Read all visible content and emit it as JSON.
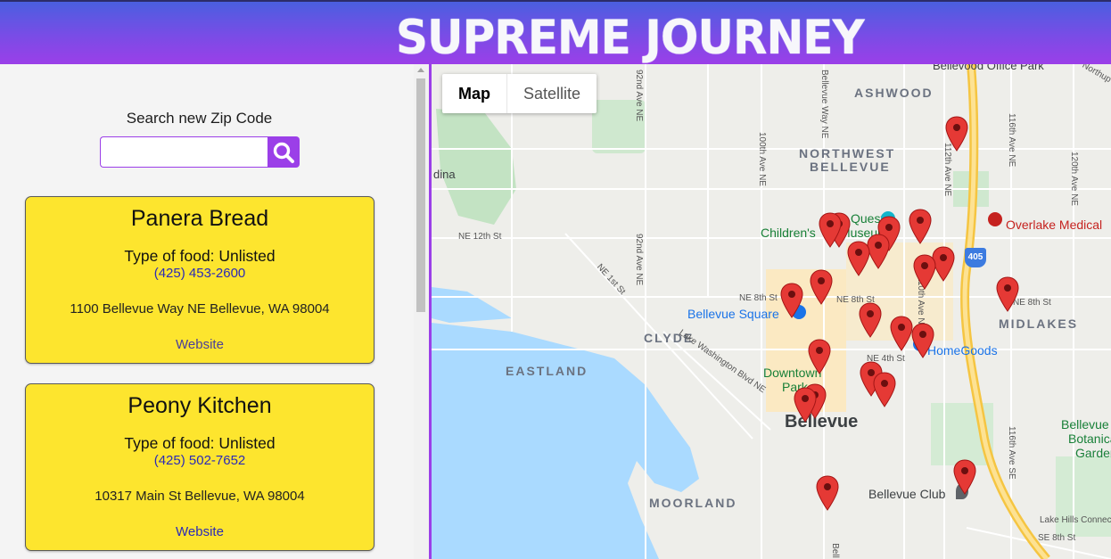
{
  "header": {
    "brand": "SUPREME JOURNEY"
  },
  "search": {
    "label": "Search new Zip Code",
    "value": "",
    "placeholder": "",
    "button_icon": "search-icon"
  },
  "results": [
    {
      "name": "Panera Bread",
      "food_type": "Type of food: Unlisted",
      "phone": "(425) 453-2600",
      "address": "1100 Bellevue Way NE Bellevue, WA 98004",
      "website": "Website"
    },
    {
      "name": "Peony Kitchen",
      "food_type": "Type of food: Unlisted",
      "phone": "(425) 502-7652",
      "address": "10317 Main St Bellevue, WA 98004",
      "website": "Website"
    }
  ],
  "map": {
    "toggle": {
      "map": "Map",
      "satellite": "Satellite"
    },
    "labels": {
      "ashwood": "ASHWOOD",
      "nw_bellevue_1": "NORTHWEST",
      "nw_bellevue_2": "BELLEVUE",
      "clyde": "CLYDE",
      "eastland": "EASTLAND",
      "midlakes": "MIDLAKES",
      "moorland": "MOORLAND",
      "bellevue": "Bellevue",
      "bellevue_square": "Bellevue Square",
      "homegoods": "HomeGoods",
      "overlake": "Overlake Medical",
      "childrens": "Children's",
      "museum": "Museum",
      "quest": "Quest",
      "downtown": "Downtown",
      "park": "Park",
      "botanical_1": "Bellevue",
      "botanical_2": "Botanica",
      "botanical_3": "Garden",
      "club": "Bellevue Club",
      "office_park": "Bellevood Office Park",
      "northup": "Northup",
      "dina": "dina",
      "ne_12th": "NE 12th St",
      "ne_8th_a": "NE 8th St",
      "ne_8th_b": "NE 8th St",
      "ne_8th_c": "NE 8th St",
      "ne_4th": "NE 4th St",
      "ne_1st": "NE 1st St",
      "lake_wash": "Lake Washington Blvd NE",
      "ave_92_a": "92nd Ave NE",
      "ave_92_b": "92nd Ave NE",
      "ave_100": "100th Ave NE",
      "bellevue_way": "Bellevue Way NE",
      "ave_112": "112th Ave NE",
      "ave_116": "116th Ave NE",
      "ave_120": "120th Ave NE",
      "ave_116_se": "116th Ave SE",
      "ave_110": "110th Ave NE",
      "se_8th": "SE 8th St",
      "lake_hills": "Lake Hills Connector",
      "hwy_405": "405",
      "bell_s": "Bell"
    }
  }
}
